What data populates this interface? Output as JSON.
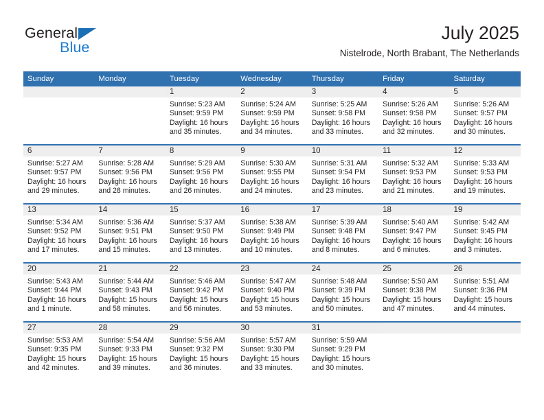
{
  "brand": {
    "name_part1": "General",
    "name_part2": "Blue",
    "accent_color": "#1b7ad1",
    "triangle_color": "#1b6fb5"
  },
  "header": {
    "title": "July 2025",
    "subtitle": "Nistelrode, North Brabant, The Netherlands"
  },
  "theme": {
    "header_blue": "#3071b0",
    "daynum_band": "#eeeeee",
    "text": "#231f20"
  },
  "weekday_headers": [
    "Sunday",
    "Monday",
    "Tuesday",
    "Wednesday",
    "Thursday",
    "Friday",
    "Saturday"
  ],
  "weeks": [
    [
      {
        "day": "",
        "lines": []
      },
      {
        "day": "",
        "lines": []
      },
      {
        "day": "1",
        "lines": [
          "Sunrise: 5:23 AM",
          "Sunset: 9:59 PM",
          "Daylight: 16 hours",
          "and 35 minutes."
        ]
      },
      {
        "day": "2",
        "lines": [
          "Sunrise: 5:24 AM",
          "Sunset: 9:59 PM",
          "Daylight: 16 hours",
          "and 34 minutes."
        ]
      },
      {
        "day": "3",
        "lines": [
          "Sunrise: 5:25 AM",
          "Sunset: 9:58 PM",
          "Daylight: 16 hours",
          "and 33 minutes."
        ]
      },
      {
        "day": "4",
        "lines": [
          "Sunrise: 5:26 AM",
          "Sunset: 9:58 PM",
          "Daylight: 16 hours",
          "and 32 minutes."
        ]
      },
      {
        "day": "5",
        "lines": [
          "Sunrise: 5:26 AM",
          "Sunset: 9:57 PM",
          "Daylight: 16 hours",
          "and 30 minutes."
        ]
      }
    ],
    [
      {
        "day": "6",
        "lines": [
          "Sunrise: 5:27 AM",
          "Sunset: 9:57 PM",
          "Daylight: 16 hours",
          "and 29 minutes."
        ]
      },
      {
        "day": "7",
        "lines": [
          "Sunrise: 5:28 AM",
          "Sunset: 9:56 PM",
          "Daylight: 16 hours",
          "and 28 minutes."
        ]
      },
      {
        "day": "8",
        "lines": [
          "Sunrise: 5:29 AM",
          "Sunset: 9:56 PM",
          "Daylight: 16 hours",
          "and 26 minutes."
        ]
      },
      {
        "day": "9",
        "lines": [
          "Sunrise: 5:30 AM",
          "Sunset: 9:55 PM",
          "Daylight: 16 hours",
          "and 24 minutes."
        ]
      },
      {
        "day": "10",
        "lines": [
          "Sunrise: 5:31 AM",
          "Sunset: 9:54 PM",
          "Daylight: 16 hours",
          "and 23 minutes."
        ]
      },
      {
        "day": "11",
        "lines": [
          "Sunrise: 5:32 AM",
          "Sunset: 9:53 PM",
          "Daylight: 16 hours",
          "and 21 minutes."
        ]
      },
      {
        "day": "12",
        "lines": [
          "Sunrise: 5:33 AM",
          "Sunset: 9:53 PM",
          "Daylight: 16 hours",
          "and 19 minutes."
        ]
      }
    ],
    [
      {
        "day": "13",
        "lines": [
          "Sunrise: 5:34 AM",
          "Sunset: 9:52 PM",
          "Daylight: 16 hours",
          "and 17 minutes."
        ]
      },
      {
        "day": "14",
        "lines": [
          "Sunrise: 5:36 AM",
          "Sunset: 9:51 PM",
          "Daylight: 16 hours",
          "and 15 minutes."
        ]
      },
      {
        "day": "15",
        "lines": [
          "Sunrise: 5:37 AM",
          "Sunset: 9:50 PM",
          "Daylight: 16 hours",
          "and 13 minutes."
        ]
      },
      {
        "day": "16",
        "lines": [
          "Sunrise: 5:38 AM",
          "Sunset: 9:49 PM",
          "Daylight: 16 hours",
          "and 10 minutes."
        ]
      },
      {
        "day": "17",
        "lines": [
          "Sunrise: 5:39 AM",
          "Sunset: 9:48 PM",
          "Daylight: 16 hours",
          "and 8 minutes."
        ]
      },
      {
        "day": "18",
        "lines": [
          "Sunrise: 5:40 AM",
          "Sunset: 9:47 PM",
          "Daylight: 16 hours",
          "and 6 minutes."
        ]
      },
      {
        "day": "19",
        "lines": [
          "Sunrise: 5:42 AM",
          "Sunset: 9:45 PM",
          "Daylight: 16 hours",
          "and 3 minutes."
        ]
      }
    ],
    [
      {
        "day": "20",
        "lines": [
          "Sunrise: 5:43 AM",
          "Sunset: 9:44 PM",
          "Daylight: 16 hours",
          "and 1 minute."
        ]
      },
      {
        "day": "21",
        "lines": [
          "Sunrise: 5:44 AM",
          "Sunset: 9:43 PM",
          "Daylight: 15 hours",
          "and 58 minutes."
        ]
      },
      {
        "day": "22",
        "lines": [
          "Sunrise: 5:46 AM",
          "Sunset: 9:42 PM",
          "Daylight: 15 hours",
          "and 56 minutes."
        ]
      },
      {
        "day": "23",
        "lines": [
          "Sunrise: 5:47 AM",
          "Sunset: 9:40 PM",
          "Daylight: 15 hours",
          "and 53 minutes."
        ]
      },
      {
        "day": "24",
        "lines": [
          "Sunrise: 5:48 AM",
          "Sunset: 9:39 PM",
          "Daylight: 15 hours",
          "and 50 minutes."
        ]
      },
      {
        "day": "25",
        "lines": [
          "Sunrise: 5:50 AM",
          "Sunset: 9:38 PM",
          "Daylight: 15 hours",
          "and 47 minutes."
        ]
      },
      {
        "day": "26",
        "lines": [
          "Sunrise: 5:51 AM",
          "Sunset: 9:36 PM",
          "Daylight: 15 hours",
          "and 44 minutes."
        ]
      }
    ],
    [
      {
        "day": "27",
        "lines": [
          "Sunrise: 5:53 AM",
          "Sunset: 9:35 PM",
          "Daylight: 15 hours",
          "and 42 minutes."
        ]
      },
      {
        "day": "28",
        "lines": [
          "Sunrise: 5:54 AM",
          "Sunset: 9:33 PM",
          "Daylight: 15 hours",
          "and 39 minutes."
        ]
      },
      {
        "day": "29",
        "lines": [
          "Sunrise: 5:56 AM",
          "Sunset: 9:32 PM",
          "Daylight: 15 hours",
          "and 36 minutes."
        ]
      },
      {
        "day": "30",
        "lines": [
          "Sunrise: 5:57 AM",
          "Sunset: 9:30 PM",
          "Daylight: 15 hours",
          "and 33 minutes."
        ]
      },
      {
        "day": "31",
        "lines": [
          "Sunrise: 5:59 AM",
          "Sunset: 9:29 PM",
          "Daylight: 15 hours",
          "and 30 minutes."
        ]
      },
      {
        "day": "",
        "lines": []
      },
      {
        "day": "",
        "lines": []
      }
    ]
  ]
}
